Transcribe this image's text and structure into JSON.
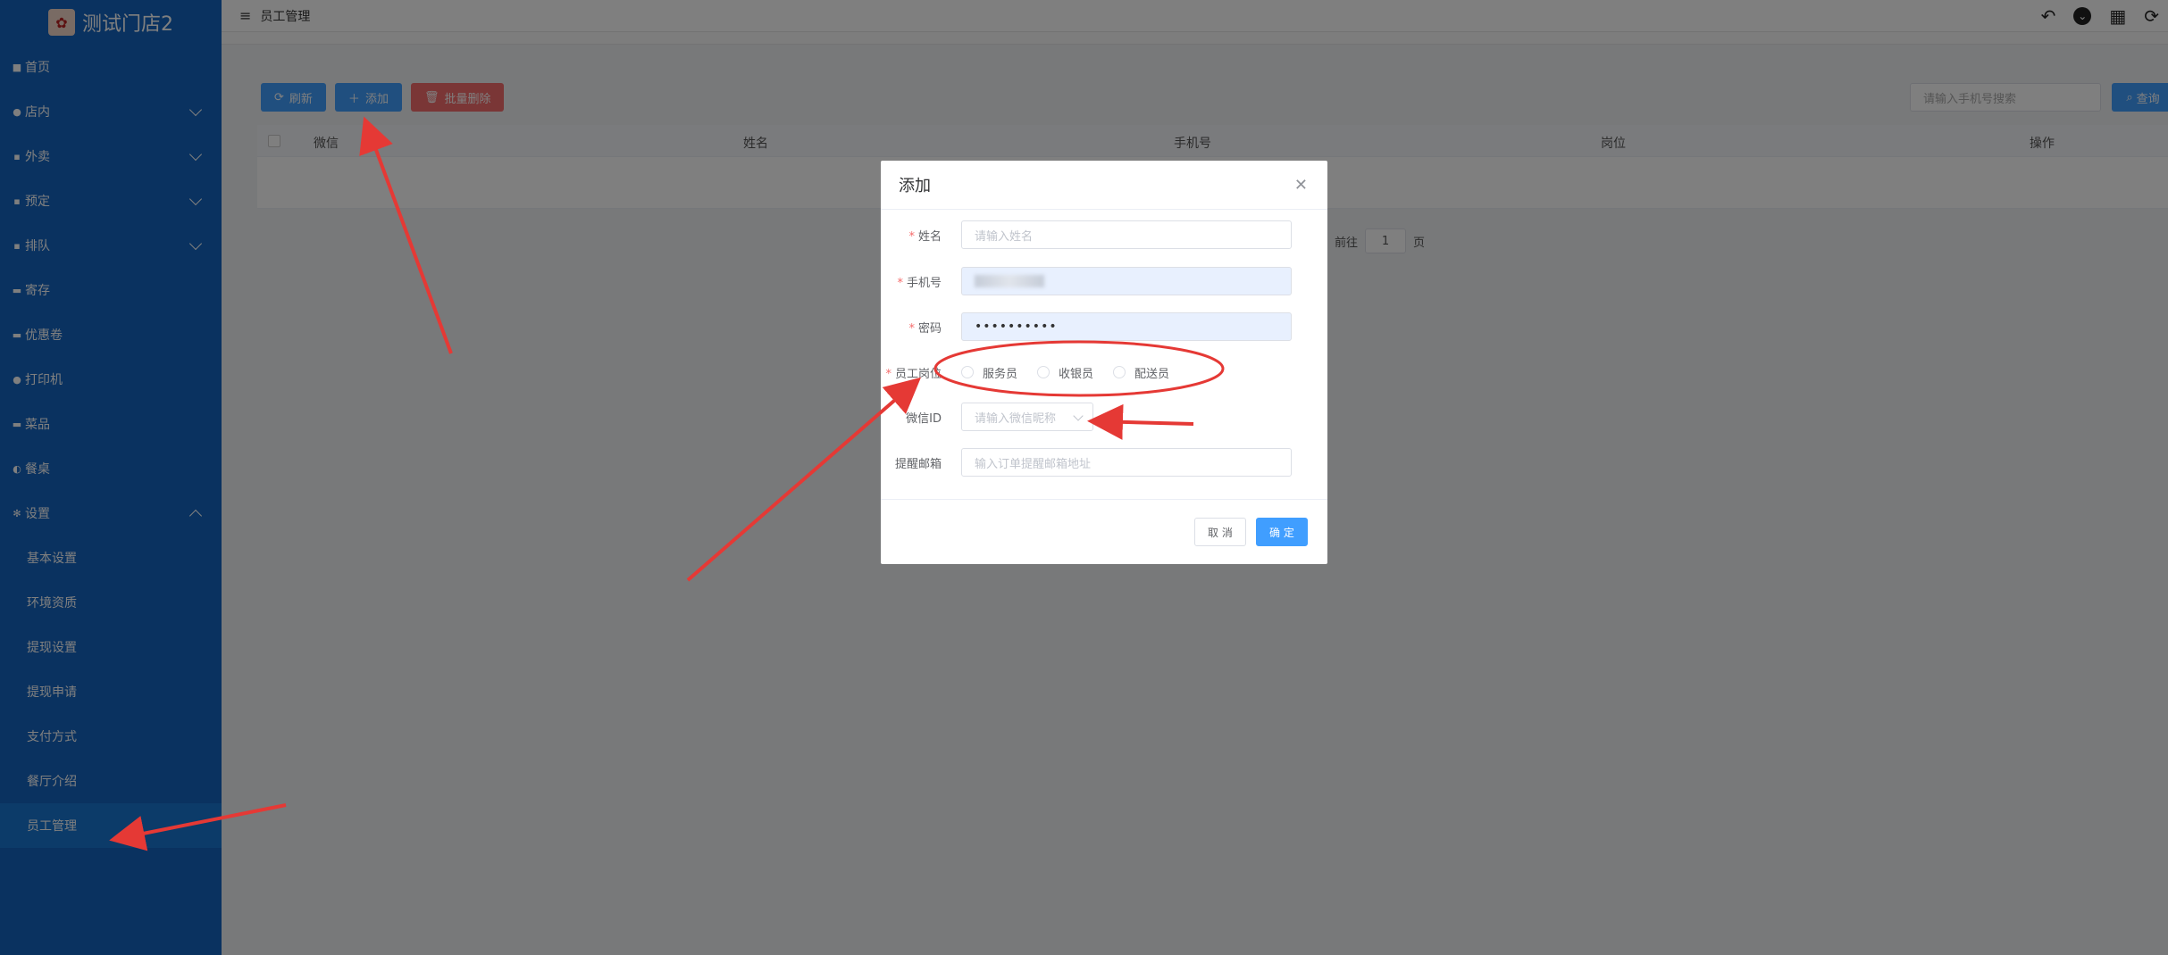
{
  "brand": {
    "name": "测试门店2",
    "logo_icon": "store-logo"
  },
  "sidebar": {
    "items": [
      {
        "label": "首页",
        "icon": "home-icon",
        "expandable": false
      },
      {
        "label": "店内",
        "icon": "user-icon",
        "expandable": true
      },
      {
        "label": "外卖",
        "icon": "delivery-icon",
        "expandable": true
      },
      {
        "label": "预定",
        "icon": "reserve-icon",
        "expandable": true
      },
      {
        "label": "排队",
        "icon": "queue-icon",
        "expandable": true
      },
      {
        "label": "寄存",
        "icon": "storage-icon",
        "expandable": false
      },
      {
        "label": "优惠卷",
        "icon": "coupon-icon",
        "expandable": false
      },
      {
        "label": "打印机",
        "icon": "printer-icon",
        "expandable": false
      },
      {
        "label": "菜品",
        "icon": "dish-icon",
        "expandable": false
      },
      {
        "label": "餐桌",
        "icon": "table-icon",
        "expandable": false
      },
      {
        "label": "设置",
        "icon": "gear-icon",
        "expandable": true,
        "expanded": true
      }
    ],
    "submenu": [
      {
        "label": "基本设置"
      },
      {
        "label": "环境资质"
      },
      {
        "label": "提现设置"
      },
      {
        "label": "提现申请"
      },
      {
        "label": "支付方式"
      },
      {
        "label": "餐厅介绍"
      },
      {
        "label": "员工管理",
        "active": true
      }
    ]
  },
  "topbar": {
    "breadcrumb": "员工管理",
    "icons": [
      "back-icon",
      "chevron-circle-icon",
      "grid-icon",
      "refresh-icon"
    ]
  },
  "toolbar": {
    "refresh_label": "刷新",
    "add_label": "添加",
    "batch_delete_label": "批量删除"
  },
  "search": {
    "placeholder": "请输入手机号搜索",
    "button_label": "查询"
  },
  "table": {
    "columns": [
      "微信",
      "姓名",
      "手机号",
      "岗位",
      "操作"
    ],
    "rows": []
  },
  "pagination": {
    "goto_label": "前往",
    "page": "1",
    "page_suffix": "页"
  },
  "dialog": {
    "title": "添加",
    "fields": {
      "name": {
        "label": "姓名",
        "required": true,
        "placeholder": "请输入姓名",
        "value": ""
      },
      "phone": {
        "label": "手机号",
        "required": true,
        "value": ""
      },
      "password": {
        "label": "密码",
        "required": true,
        "value": "••••••••••"
      },
      "position": {
        "label": "员工岗位",
        "required": true,
        "options": [
          "服务员",
          "收银员",
          "配送员"
        ]
      },
      "wechat_id": {
        "label": "微信ID",
        "required": false,
        "placeholder": "请输入微信昵称"
      },
      "email": {
        "label": "提醒邮箱",
        "required": false,
        "placeholder": "输入订单提醒邮箱地址"
      }
    },
    "cancel_label": "取 消",
    "ok_label": "确 定"
  },
  "colors": {
    "sidebar": "#1565c0",
    "primary": "#409eff",
    "danger": "#f56c6c",
    "annotation": "#e53935"
  }
}
